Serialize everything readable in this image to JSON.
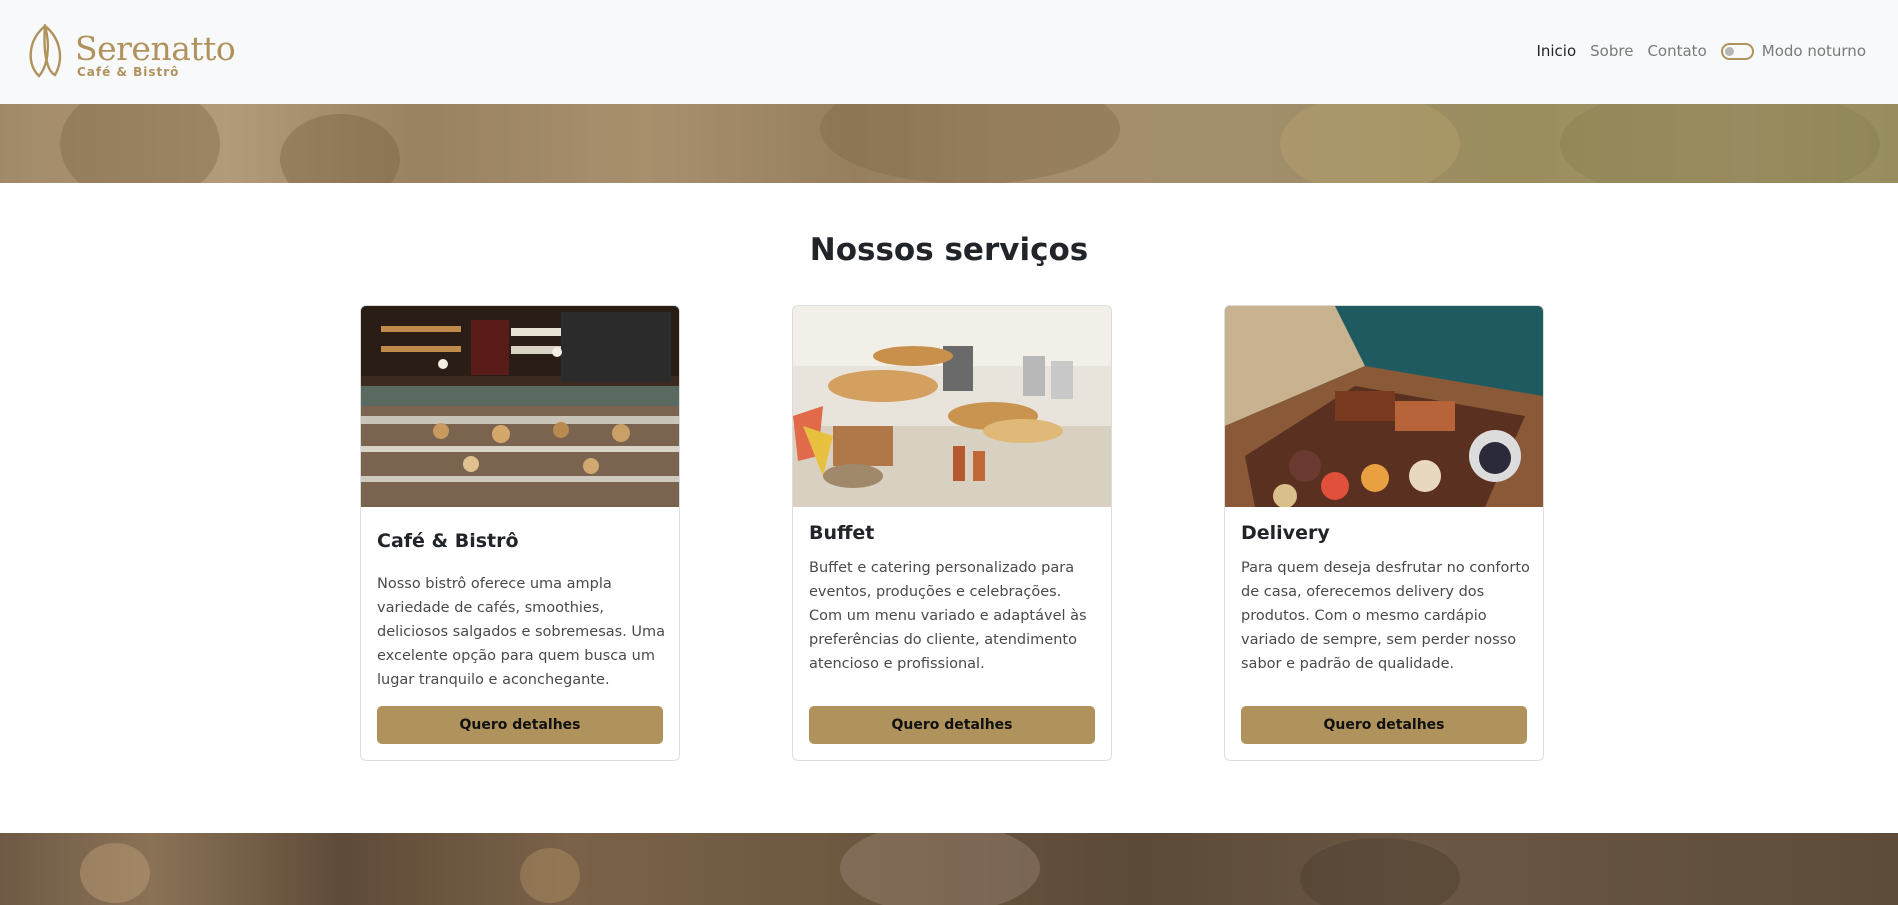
{
  "brand": {
    "name": "Serenatto",
    "tagline": "Café & Bistrô",
    "color": "#b0925d"
  },
  "nav": {
    "items": [
      {
        "label": "Inicio",
        "active": true
      },
      {
        "label": "Sobre",
        "active": false
      },
      {
        "label": "Contato",
        "active": false
      }
    ],
    "dark_mode_label": "Modo noturno",
    "dark_mode_on": false
  },
  "services": {
    "title": "Nossos serviços",
    "cards": [
      {
        "title": "Café & Bistrô",
        "text": "Nosso bistrô oferece uma ampla variedade de cafés, smoothies, deliciosos salgados e sobremesas. Uma excelente opção para quem busca um lugar tranquilo e aconchegante.",
        "button": "Quero detalhes",
        "image": "cafe-counter-photo"
      },
      {
        "title": "Buffet",
        "text": "Buffet e catering personalizado para eventos, produções e celebrações. Com um menu variado e adaptável às preferências do cliente, atendimento atencioso e profissional.",
        "button": "Quero detalhes",
        "image": "buffet-table-photo"
      },
      {
        "title": "Delivery",
        "text": "Para quem deseja desfrutar no conforto de casa, oferecemos delivery dos produtos. Com o mesmo cardápio variado de sempre, sem perder nosso sabor e padrão de qualidade.",
        "button": "Quero detalhes",
        "image": "delivery-box-photo"
      }
    ]
  }
}
